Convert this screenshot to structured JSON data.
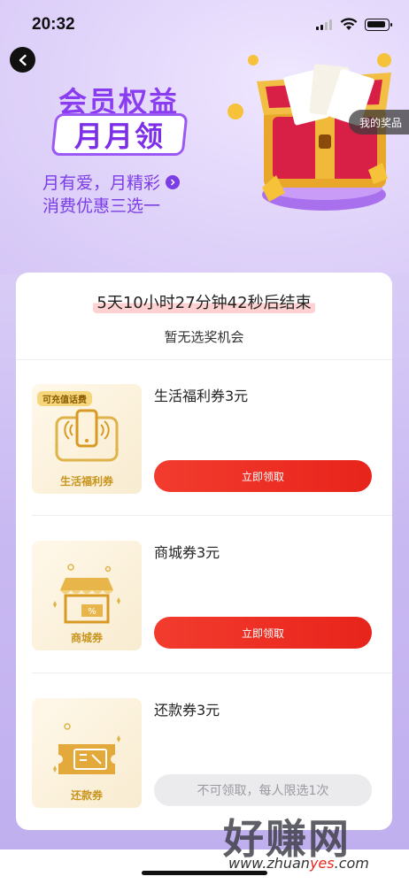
{
  "status_bar": {
    "time": "20:32"
  },
  "header": {
    "title_line1": "会员权益",
    "title_line2": "月月领",
    "subtitle_line1": "月有爱，月精彩",
    "subtitle_line2": "消费优惠三选一",
    "my_prizes": "我的奖品",
    "accent_color": "#8a3df0"
  },
  "card": {
    "countdown": "5天10小时27分钟42秒后结束",
    "no_chance": "暂无选奖机会",
    "coupons": [
      {
        "title": "生活福利券3元",
        "thumb_caption": "生活福利券",
        "thumb_tag": "可充值话费",
        "icon": "phone-icon",
        "button": "立即领取",
        "button_state": "active"
      },
      {
        "title": "商城券3元",
        "thumb_caption": "商城券",
        "icon": "shop-icon",
        "button": "立即领取",
        "button_state": "active"
      },
      {
        "title": "还款券3元",
        "thumb_caption": "还款券",
        "icon": "ticket-icon",
        "button": "不可领取，每人限选1次",
        "button_state": "disabled"
      }
    ],
    "button_color": "#e8241b"
  },
  "watermark": {
    "text": "好赚网",
    "url_prefix": "www.zhuan",
    "url_highlight": "yes",
    "url_suffix": ".com"
  }
}
